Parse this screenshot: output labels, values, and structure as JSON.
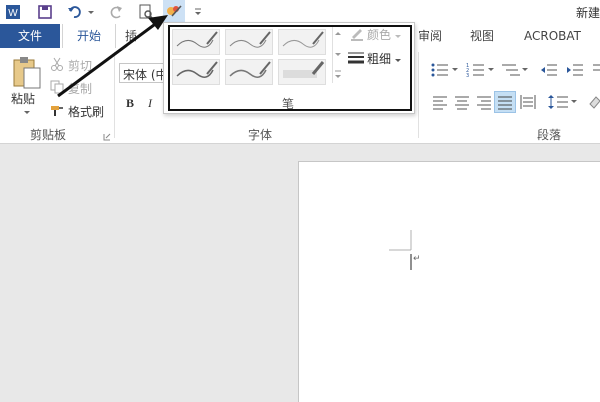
{
  "window": {
    "title": "新建"
  },
  "quick_access": {
    "items": [
      {
        "icon": "word-icon"
      },
      {
        "icon": "save-icon"
      },
      {
        "icon": "undo-icon"
      },
      {
        "icon": "redo-icon"
      },
      {
        "icon": "print-preview-icon"
      },
      {
        "icon": "pen-icon"
      },
      {
        "icon": "customize-icon"
      }
    ]
  },
  "tabs": {
    "file": "文件",
    "home": "开始",
    "insert_partial": "插",
    "review": "审阅",
    "view": "视图",
    "acrobat": "ACROBAT"
  },
  "clipboard": {
    "paste": "粘贴",
    "cut": "剪切",
    "copy": "复制",
    "format_painter": "格式刷",
    "group_label": "剪贴板"
  },
  "font": {
    "font_name": "宋体 (中",
    "bold": "B",
    "italic": "I",
    "group_label": "字体"
  },
  "pen_gallery": {
    "color_label": "颜色",
    "weight_label": "粗细",
    "group_label": "笔"
  },
  "paragraph": {
    "group_label": "段落"
  },
  "document": {
    "cursor_mark": "↵"
  },
  "colors": {
    "accent": "#2b579a",
    "selected_align": "#c5dff4"
  }
}
